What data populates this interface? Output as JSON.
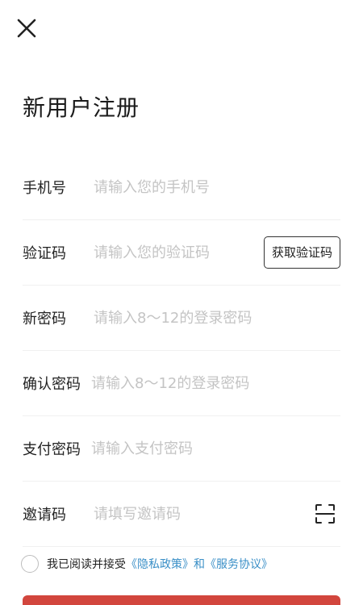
{
  "header": {
    "close_icon": "close-icon",
    "title": "新用户注册"
  },
  "form": {
    "phone": {
      "label": "手机号",
      "placeholder": "请输入您的手机号"
    },
    "code": {
      "label": "验证码",
      "placeholder": "请输入您的验证码",
      "button": "获取验证码"
    },
    "password": {
      "label": "新密码",
      "placeholder": "请输入8～12的登录密码"
    },
    "confirm": {
      "label": "确认密码",
      "placeholder": "请输入8～12的登录密码"
    },
    "pay_password": {
      "label": "支付密码",
      "placeholder": "请输入支付密码"
    },
    "invite": {
      "label": "邀请码",
      "placeholder": "请填写邀请码",
      "scan_icon": "scan-icon"
    }
  },
  "agreement": {
    "prefix": "我已阅读并接受",
    "privacy": "《隐私政策》",
    "and": "和",
    "service": "《服务协议》",
    "link_color": "#3a8fc7"
  },
  "submit": {
    "color": "#d2463d"
  }
}
